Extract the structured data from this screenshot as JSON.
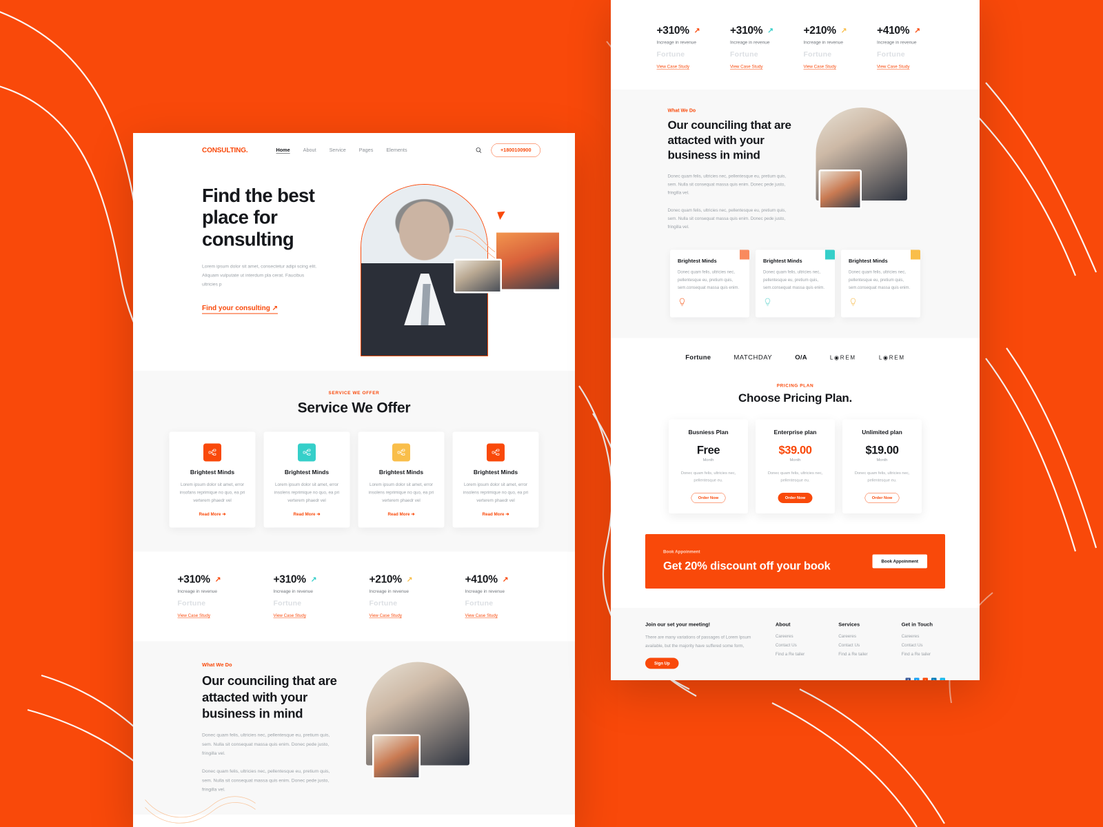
{
  "theme": {
    "brand_orange": "#F9490A",
    "cyan": "#35CFC9",
    "yellow": "#F9BE4A",
    "dark": "#16181c"
  },
  "nav": {
    "logo": "CONSULTING.",
    "links": [
      {
        "label": "Home",
        "active": true
      },
      {
        "label": "About",
        "active": false
      },
      {
        "label": "Service",
        "active": false
      },
      {
        "label": "Pages",
        "active": false
      },
      {
        "label": "Elements",
        "active": false
      }
    ],
    "search_icon": "search-icon",
    "phone": "+1800100900"
  },
  "hero": {
    "title": "Find the best place for consulting",
    "paragraph": "Lorem ipsum dolor sit amet, consectetur adipi  scing elit. Aliquam vulputate ut interdum pla cerat. Faucibus ultricies p",
    "cta": "Find your consulting ↗"
  },
  "services": {
    "eyebrow": "SERVICE WE OFFER",
    "title": "Service We Offer",
    "cards": [
      {
        "title": "Brightest Minds",
        "text": "Lorem ipsum dolor sit amet, error insofans reprimique no quo, ea pri verterem phaedr vel",
        "link": "Read More ➜",
        "color": "#F9490A"
      },
      {
        "title": "Brightest Minds",
        "text": "Lorem ipsum dolor sit amet, error insolens reprimique no quo, ea pri verterem phaedr vel",
        "link": "Read More ➜",
        "color": "#35CFC9"
      },
      {
        "title": "Brightest Minds",
        "text": "Lorem ipsum dolor sit amet, error insolens reprimique no quo, ea pri verterem phaedr vel",
        "link": "Read More ➜",
        "color": "#F9BE4A"
      },
      {
        "title": "Brightest Minds",
        "text": "Lorem ipsum dolor sit amet, error insolens reprimique no quo, ea pri verterem phaedr vel",
        "link": "Read More ➜",
        "color": "#F9490A"
      }
    ]
  },
  "stats": [
    {
      "value": "+310%",
      "label": "Increage in revenue",
      "brand": "Fortune",
      "link": "View Case Study",
      "arrow_color": "#F9490A"
    },
    {
      "value": "+310%",
      "label": "Increage in revenue",
      "brand": "Fortune",
      "link": "View Case Study",
      "arrow_color": "#35CFC9"
    },
    {
      "value": "+210%",
      "label": "Increage in revenue",
      "brand": "Fortune",
      "link": "View Case Study",
      "arrow_color": "#F9BE4A"
    },
    {
      "value": "+410%",
      "label": "Increage in revenue",
      "brand": "Fortune",
      "link": "View Case Study",
      "arrow_color": "#F9490A"
    }
  ],
  "what_we_do": {
    "eyebrow": "What We Do",
    "title": "Our counciling that are attacted with your business in mind",
    "paragraph_1": "Donec quam felis, ultricies nec, pellentesque eu, pretium quis, sem. Nulla sit consequat massa quis enim. Donec pede justo, fringilla vel.",
    "paragraph_2": "Donec quam felis, ultricies nec, pellentesque eu, pretium quis, sem. Nulla sit consequat massa quis enim. Donec pede justo, fringilla vel."
  },
  "minds": [
    {
      "title": "Brightest Minds",
      "text": "Donec quam felis, ultricies nec, pellentesque eu, pretium quis, sem.consequat massa quis enim.",
      "color": "#F98A5E",
      "bulb": "💡"
    },
    {
      "title": "Brightest Minds",
      "text": "Donec quam felis, ultricies nec, pellentesque eu, pretium quis, sem.consequat massa quis enim.",
      "color": "#35CFC9",
      "bulb": "💡"
    },
    {
      "title": "Brightest Minds",
      "text": "Donec quam felis, ultricies nec, pellentesque eu, pretium quis, sem.consequat massa quis enim.",
      "color": "#F9BE4A",
      "bulb": "💡"
    }
  ],
  "brands": [
    {
      "name": "Fortune",
      "style": "bold"
    },
    {
      "name": "MATCHDAY",
      "style": "normal"
    },
    {
      "name": "O/A",
      "style": "bold"
    },
    {
      "name": "L◉REM",
      "style": "thin"
    },
    {
      "name": "L◉REM",
      "style": "thin"
    }
  ],
  "pricing": {
    "eyebrow": "PRICING PLAN",
    "title": "Choose Pricing Plan.",
    "plans": [
      {
        "name": "Busniess Plan",
        "price": "Free",
        "per": "Month",
        "text": "Donec quam felis, ultricies nec, pellentesque eu.",
        "button": "Order Now",
        "highlight": false
      },
      {
        "name": "Enterprise plan",
        "price": "$39.00",
        "per": "Month",
        "text": "Donec quam felis, ultricies nec, pellentesque eu.",
        "button": "Order Now",
        "highlight": true
      },
      {
        "name": "Unlimited plan",
        "price": "$19.00",
        "per": "Month",
        "text": "Donec quam felis, ultricies nec, pellentesque eu.",
        "button": "Order Now",
        "highlight": false
      }
    ]
  },
  "cta": {
    "eyebrow": "Book Appoinment",
    "title": "Get 20% discount off your book",
    "button": "Book Appoinment"
  },
  "footer": {
    "heading": "Join our set your meeting!",
    "text": "There are many variations of passages of Lorem Ipsum available, but the majority have suffered some form,",
    "signup": "Sign Up",
    "columns": [
      {
        "title": "About",
        "links": [
          "Careeres",
          "Contact Us",
          "Find a Re tailer"
        ]
      },
      {
        "title": "Services",
        "links": [
          "Careeres",
          "Contact Us",
          "Find a Re tailer"
        ]
      },
      {
        "title": "Get in Touch",
        "links": [
          "Careeres",
          "Contact Us",
          "Find a Re tailer"
        ]
      }
    ],
    "socials": [
      {
        "name": "facebook-icon",
        "glyph": "f",
        "color": "#3b5998"
      },
      {
        "name": "twitter-icon",
        "glyph": "t",
        "color": "#1da1f2"
      },
      {
        "name": "rss-icon",
        "glyph": "r",
        "color": "#F9490A"
      },
      {
        "name": "linkedin-icon",
        "glyph": "in",
        "color": "#0077b5"
      },
      {
        "name": "vimeo-icon",
        "glyph": "v",
        "color": "#1ab7ea"
      }
    ]
  }
}
